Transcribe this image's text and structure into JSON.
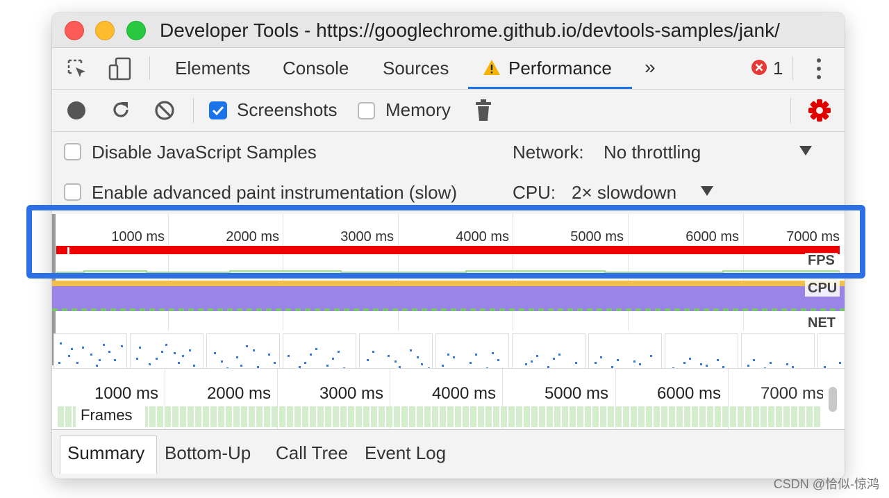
{
  "window": {
    "title": "Developer Tools - https://googlechrome.github.io/devtools-samples/jank/"
  },
  "tabs": [
    {
      "label": "Elements"
    },
    {
      "label": "Console"
    },
    {
      "label": "Sources"
    },
    {
      "label": "Performance",
      "active": true,
      "warning": true
    }
  ],
  "tabs_overflow": "»",
  "errors": {
    "count": "1"
  },
  "toolbar": {
    "screenshots_label": "Screenshots",
    "screenshots_checked": true,
    "memory_label": "Memory",
    "memory_checked": false
  },
  "options": {
    "disable_js_samples": "Disable JavaScript Samples",
    "advanced_paint": "Enable advanced paint instrumentation (slow)",
    "network_label": "Network:",
    "network_value": "No throttling",
    "cpu_label": "CPU:",
    "cpu_value": "2× slowdown"
  },
  "overview": {
    "ticks": [
      "1000 ms",
      "2000 ms",
      "3000 ms",
      "4000 ms",
      "5000 ms",
      "6000 ms",
      "7000 ms"
    ],
    "fps_label": "FPS",
    "cpu_label": "CPU",
    "net_label": "NET"
  },
  "details": {
    "ticks": [
      "1000 ms",
      "2000 ms",
      "3000 ms",
      "4000 ms",
      "5000 ms",
      "6000 ms",
      "7000 ms"
    ],
    "frames_label": "Frames"
  },
  "bottom_tabs": [
    {
      "label": "Summary",
      "active": true
    },
    {
      "label": "Bottom-Up"
    },
    {
      "label": "Call Tree"
    },
    {
      "label": "Event Log"
    }
  ],
  "watermark": "CSDN @恰似-惊鸿",
  "colors": {
    "accent": "#1a73e8",
    "highlight": "#2f6fe4",
    "fps_red": "#ee0000",
    "fps_green": "#8fd27f",
    "cpu_purple": "#9a84e6",
    "cpu_yellow": "#f2c04a",
    "error_red": "#e53935",
    "warning_yellow": "#f5b400"
  }
}
